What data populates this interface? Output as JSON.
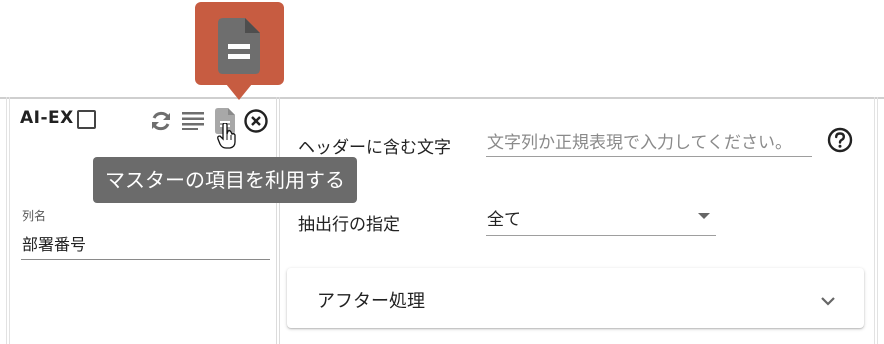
{
  "card": {
    "title": "AI-EX",
    "tooltip": "マスターの項目を利用する",
    "icons": [
      "checkbox-icon",
      "refresh-icon",
      "list-icon",
      "document-icon",
      "close-circle-icon",
      "cursor-hand-icon"
    ],
    "column_field": {
      "label": "列名",
      "value": "部署番号"
    }
  },
  "settings": {
    "header_label": "ヘッダーに含む文字",
    "header_placeholder": "文字列か正規表現で入力してください。",
    "extract_label": "抽出行の指定",
    "extract_value": "全て",
    "after_process_label": "アフター処理"
  },
  "colors": {
    "callout": "#c75c41",
    "tooltip_bg": "#6b6b6b",
    "icon_gray": "#6e6e6e"
  }
}
